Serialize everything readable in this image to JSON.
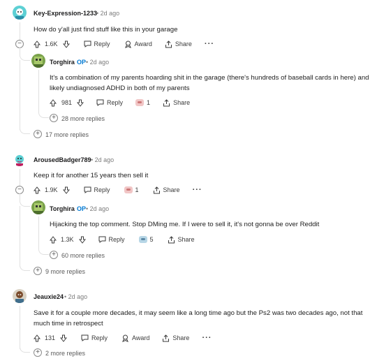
{
  "colors": {
    "op_blue": "#0079d3",
    "rail": "#e0e0e0",
    "upvote": "#3a3a3a"
  },
  "threads": [
    {
      "user": "Key-Expression-1233",
      "age": "2d ago",
      "text": "How do y'all just find stuff like this in your garage",
      "votes": "1.6K",
      "reply_label": "Reply",
      "award_label": "Award",
      "share_label": "Share",
      "more_icon": "ellipsis-icon",
      "reply": {
        "user": "Torghira",
        "op_badge": "OP",
        "age": "2d ago",
        "text": "It's a combination of my parents hoarding shit in the garage (there's hundreds of baseball cards in here) and likely undiagnosed ADHD in both of my parents",
        "votes": "981",
        "reply_label": "Reply",
        "award_count": "1",
        "share_label": "Share",
        "more_replies": "28 more replies"
      },
      "more_replies": "17 more replies"
    },
    {
      "user": "ArousedBadger789",
      "age": "2d ago",
      "text": "Keep it for another 15 years then sell it",
      "votes": "1.9K",
      "reply_label": "Reply",
      "award_count": "1",
      "share_label": "Share",
      "more_icon": "ellipsis-icon",
      "reply": {
        "user": "Torghira",
        "op_badge": "OP",
        "age": "2d ago",
        "text": "Hijacking the top comment. Stop DMing me. If I were to sell it, it's not gonna be over Reddit",
        "votes": "1.3K",
        "reply_label": "Reply",
        "award_count": "5",
        "share_label": "Share",
        "more_replies": "60 more replies"
      },
      "more_replies": "9 more replies"
    },
    {
      "user": "Jeauxie24",
      "age": "2d ago",
      "text": "Save it for a couple more decades, it may seem like a long time ago but the Ps2 was two decades ago, not that much time in retrospect",
      "votes": "131",
      "reply_label": "Reply",
      "award_label": "Award",
      "share_label": "Share",
      "more_icon": "ellipsis-icon",
      "more_replies": "2 more replies"
    }
  ]
}
